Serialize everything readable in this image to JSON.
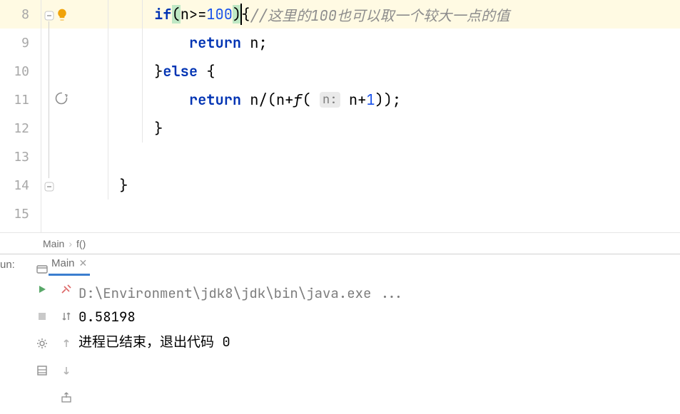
{
  "gutter": {
    "lines": [
      "8",
      "9",
      "10",
      "11",
      "12",
      "13",
      "14",
      "15"
    ]
  },
  "code": {
    "l8": {
      "k_if": "if",
      "v_n": "n",
      "op": ">=",
      "num": "100",
      "brace": "{",
      "comment": "//这里的100也可以取一个较大一点的值"
    },
    "l9": {
      "k_return": "return",
      "rest": " n;"
    },
    "l10": {
      "brace": "}",
      "k_else": "else",
      "open": " {"
    },
    "l11": {
      "k_return": "return",
      "pre": " n/(n+",
      "fname": "f",
      "hint": "n:",
      "arg": " n+",
      "one": "1",
      "tail": "));"
    },
    "l12": {
      "brace": "}"
    },
    "l14": {
      "brace": "}"
    }
  },
  "breadcrumb": {
    "a": "Main",
    "b": "f()"
  },
  "run": {
    "label": "un:",
    "tab": "Main",
    "cmd": "D:\\Environment\\jdk8\\jdk\\bin\\java.exe ...",
    "out1": "0.58198",
    "proc_a": "进程已结束，退出代码 ",
    "proc_b": "0"
  }
}
